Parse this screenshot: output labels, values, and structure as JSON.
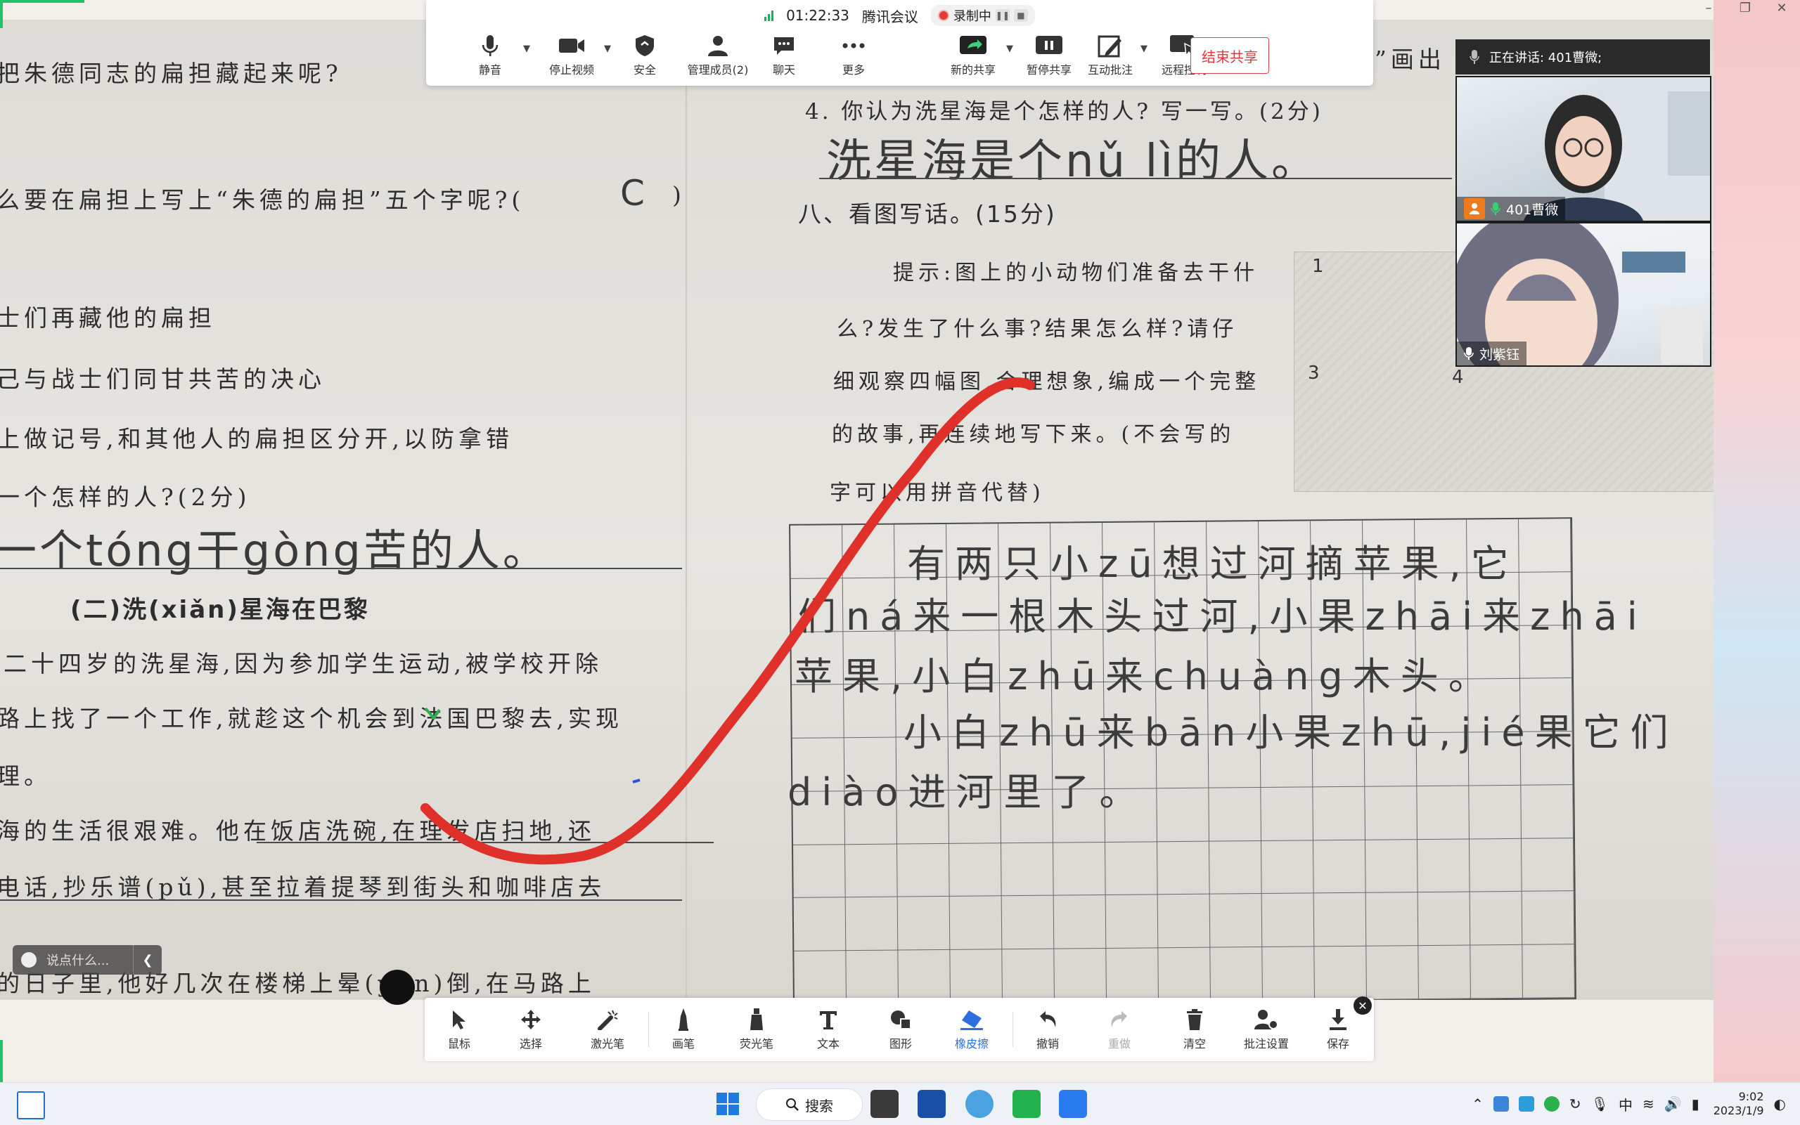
{
  "meeting": {
    "app_name": "腾讯会议",
    "duration": "01:22:33",
    "recording_label": "录制中",
    "tools": [
      {
        "label": "静音",
        "icon": "microphone-icon"
      },
      {
        "label": "停止视频",
        "icon": "camera-icon"
      },
      {
        "label": "安全",
        "icon": "shield-icon"
      },
      {
        "label": "管理成员(2)",
        "icon": "members-icon"
      },
      {
        "label": "聊天",
        "icon": "chat-icon"
      },
      {
        "label": "更多",
        "icon": "more-icon"
      },
      {
        "label": "新的共享",
        "icon": "share-icon"
      },
      {
        "label": "暂停共享",
        "icon": "pause-icon"
      },
      {
        "label": "互动批注",
        "icon": "annotate-icon"
      },
      {
        "label": "远程控制",
        "icon": "remote-control-icon"
      }
    ],
    "end_share_label": "结束共享",
    "speaking_label": "正在讲话: 401曹微;"
  },
  "participants": [
    {
      "name": "401曹微",
      "is_host": true
    },
    {
      "name": "刘紫钰",
      "is_host": false
    }
  ],
  "document": {
    "left_lines": [
      "把朱德同志的扁担藏起来呢?",
      "么要在扁担上写上“朱德的扁担”五个字呢?(",
      "士们再藏他的扁担",
      "己与战士们同甘共苦的决心",
      "上做记号,和其他人的扁担区分开,以防拿错",
      "一个怎样的人?(2分)",
      "(二)洗(xiǎn)星海在巴黎",
      "二十四岁的洗星海,因为参加学生运动,被学校开除",
      "路上找了一个工作,就趁这个机会到法国巴黎去,实现",
      "理。",
      "海的生活很艰难。他在饭店洗碗,在理发店扫地,还",
      "电话,抄乐谱(pǔ),甚至拉着提琴到街头和咖啡店去",
      "的日子里,他好几次在楼梯上晕(yūn)倒,在马路上"
    ],
    "left_answer_c": "C",
    "left_answer_handwriting": "一个tóng干gòng苦的人。",
    "right_top_fragment": "”画出",
    "right_lines": [
      "4. 你认为洗星海是个怎样的人? 写一写。(2分)",
      "八、看图写话。(15分)",
      "提示:图上的小动物们准备去干什",
      "么?发生了什么事?结果怎么样?请仔",
      "细观察四幅图,合理想象,编成一个完整",
      "的故事,再连续地写下来。(不会写的",
      "字可以用拼音代替)"
    ],
    "right_answer_handwriting": "洗星海是个nǔ lì的人。",
    "picture_numbers": [
      "1",
      "3",
      "4"
    ],
    "grid_rows": [
      "有两只小zū想过河摘苹果,它",
      "们ná来一根木头过河,小果zhāi来zhāi",
      "苹果,小白zhū来chuàng木头。",
      "小白zhū来bān小果zhū,jié果它们",
      "diào进河里了。"
    ]
  },
  "annotation_tools": [
    {
      "label": "鼠标",
      "icon": "cursor-icon",
      "state": "normal"
    },
    {
      "label": "选择",
      "icon": "move-icon",
      "state": "normal"
    },
    {
      "label": "激光笔",
      "icon": "laser-pointer-icon",
      "state": "normal"
    },
    {
      "label": "画笔",
      "icon": "pen-icon",
      "state": "normal"
    },
    {
      "label": "荧光笔",
      "icon": "highlighter-icon",
      "state": "normal"
    },
    {
      "label": "文本",
      "icon": "text-icon",
      "state": "normal"
    },
    {
      "label": "图形",
      "icon": "shapes-icon",
      "state": "normal"
    },
    {
      "label": "橡皮擦",
      "icon": "eraser-icon",
      "state": "active"
    },
    {
      "label": "撤销",
      "icon": "undo-icon",
      "state": "normal"
    },
    {
      "label": "重做",
      "icon": "redo-icon",
      "state": "disabled"
    },
    {
      "label": "清空",
      "icon": "trash-icon",
      "state": "normal"
    },
    {
      "label": "批注设置",
      "icon": "annotation-settings-icon",
      "state": "normal"
    },
    {
      "label": "保存",
      "icon": "save-icon",
      "state": "normal"
    }
  ],
  "chat": {
    "placeholder": "说点什么..."
  },
  "taskbar": {
    "search_label": "搜索",
    "ime_label": "中",
    "time": "9:02",
    "date": "2023/1/9"
  },
  "colors": {
    "accent_blue": "#2e6fe0",
    "recording_red": "#e8393b",
    "end_share_red": "#e03a3a",
    "annotation_stroke_red": "#e0302a",
    "window_border_green": "#21c26a"
  }
}
